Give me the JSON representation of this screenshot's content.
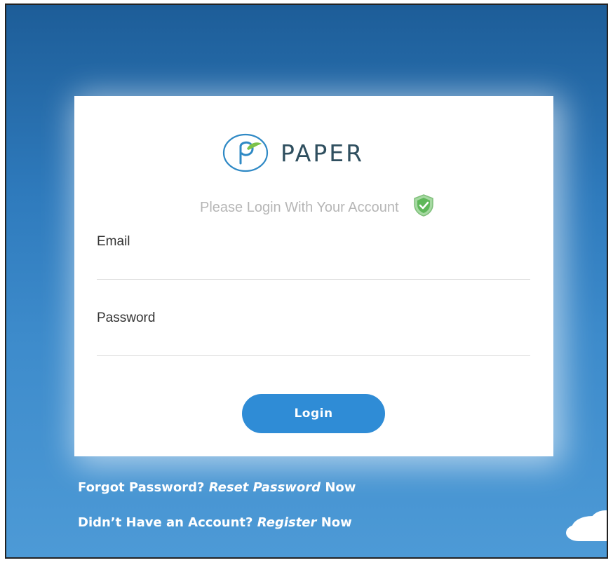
{
  "brand": {
    "name": "PAPER",
    "logo_icon": "paper-logo-icon",
    "color": "#2f4f5f"
  },
  "form": {
    "subtitle": "Please Login With Your Account",
    "subtitle_icon": "shield-check-icon",
    "email_label": "Email",
    "email_value": "",
    "password_label": "Password",
    "password_value": "",
    "login_label": "Login",
    "accent": "#2f8cd6"
  },
  "links": {
    "forgot_prefix": "Forgot Password?",
    "forgot_link": "Reset Password",
    "forgot_suffix": "Now",
    "register_prefix": "Didn’t Have an Account?",
    "register_link": "Register",
    "register_suffix": "Now"
  },
  "decor": {
    "cloud_icon": "cloud-icon"
  }
}
